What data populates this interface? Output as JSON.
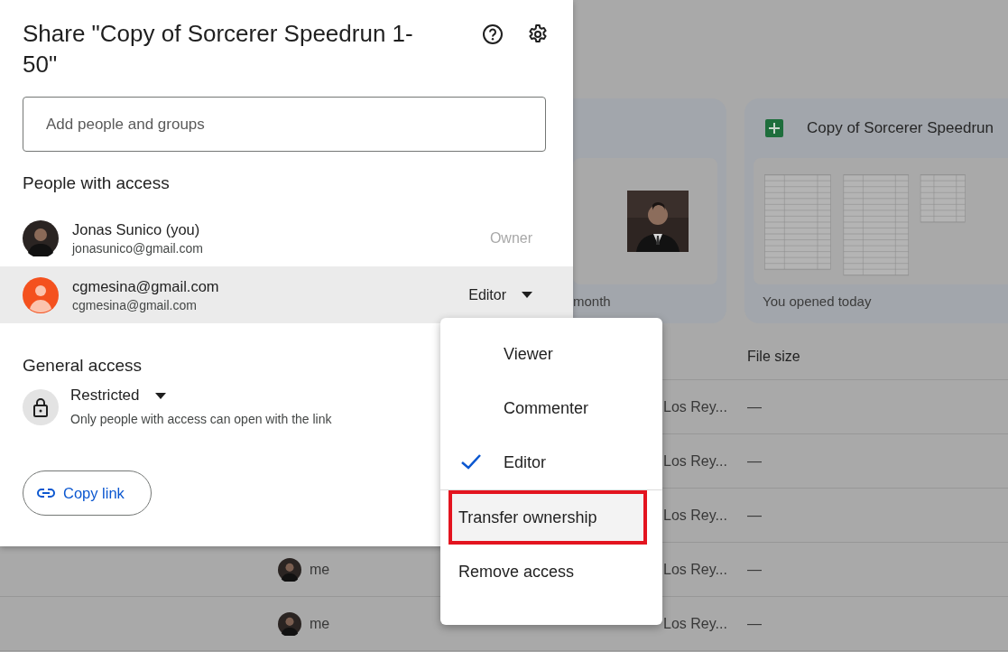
{
  "dialog": {
    "title": "Share \"Copy of Sorcerer Speedrun 1-50\"",
    "search": {
      "placeholder": "Add people and groups"
    },
    "people_heading": "People with access",
    "people": [
      {
        "name": "Jonas Sunico (you)",
        "email": "jonasunico@gmail.com",
        "role": "Owner",
        "role_editable": false,
        "highlighted": false
      },
      {
        "name": "cgmesina@gmail.com",
        "email": "cgmesina@gmail.com",
        "role": "Editor",
        "role_editable": true,
        "highlighted": true,
        "kind": "default"
      }
    ],
    "general_heading": "General access",
    "general": {
      "setting": "Restricted",
      "description": "Only people with access can open with the link"
    },
    "copy_link": "Copy link"
  },
  "role_menu": {
    "items": [
      {
        "label": "Viewer",
        "kind": "role",
        "selected": false,
        "highlighted": false
      },
      {
        "label": "Commenter",
        "kind": "role",
        "selected": false,
        "highlighted": false
      },
      {
        "label": "Editor",
        "kind": "role",
        "selected": true,
        "highlighted": false
      },
      {
        "label": "Transfer ownership",
        "kind": "action",
        "highlighted": true
      },
      {
        "label": "Remove access",
        "kind": "action",
        "highlighted": false
      }
    ]
  },
  "background": {
    "cards": [
      {
        "kind": "doc",
        "footer": "month"
      },
      {
        "kind": "sheet",
        "title": "Copy of Sorcerer Speedrun",
        "footer": "You opened today"
      }
    ],
    "table": {
      "columns": [
        {
          "label": "File size"
        }
      ],
      "rows": [
        {
          "location": "Los Rey...",
          "file_size": "—"
        },
        {
          "location": "Los Rey...",
          "file_size": "—"
        },
        {
          "location": "Los Rey...",
          "file_size": "—"
        },
        {
          "owner": "me",
          "location": "Los Rey...",
          "file_size": "—"
        },
        {
          "owner": "me",
          "location": "Los Rey...",
          "file_size": "—"
        }
      ]
    }
  }
}
